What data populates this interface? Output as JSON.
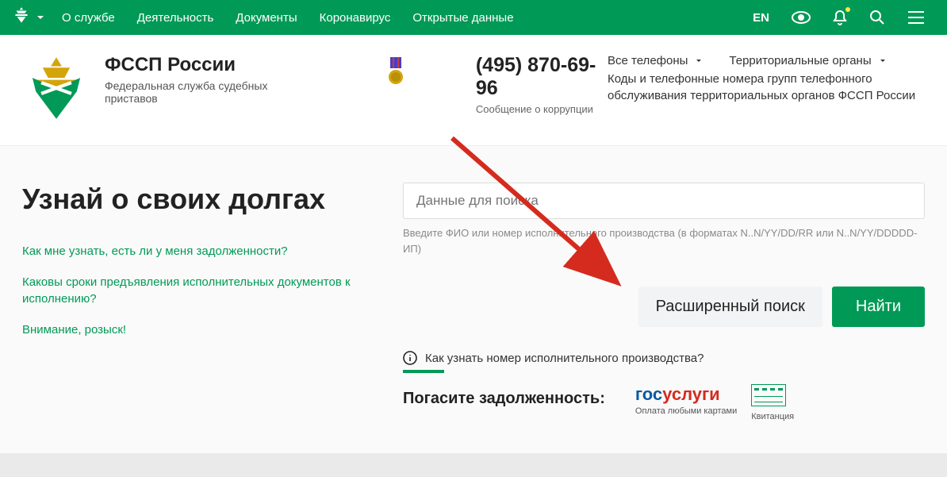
{
  "topbar": {
    "nav": [
      "О службе",
      "Деятельность",
      "Документы",
      "Коронавирус",
      "Открытые данные"
    ],
    "lang": "EN"
  },
  "header": {
    "title": "ФССП России",
    "subtitle": "Федеральная служба судебных приставов",
    "phone": "(495) 870-69-96",
    "phone_sub": "Сообщение о коррупции",
    "dd1": "Все телефоны",
    "dd2": "Территориальные органы",
    "desc": "Коды и телефонные номера групп телефонного обслуживания территориальных органов ФССП России"
  },
  "main": {
    "heading": "Узнай о своих долгах",
    "faq1": "Как мне узнать, есть ли у меня задолженности?",
    "faq2": "Каковы сроки предъявления исполнительных документов к исполнению?",
    "faq3": "Внимание, розыск!",
    "placeholder": "Данные для поиска",
    "hint": "Введите ФИО или номер исполнительного производства (в форматах N..N/YY/DD/RR или N..N/YY/DDDDD-ИП)",
    "adv": "Расширенный поиск",
    "find": "Найти",
    "howto": "Как узнать номер исполнительного производства?",
    "pay_title": "Погасите задолженность:",
    "gos1": "гос",
    "gos2": "услуги",
    "pay_sub1": "Оплата любыми картами",
    "pay_sub2": "Квитанция"
  }
}
